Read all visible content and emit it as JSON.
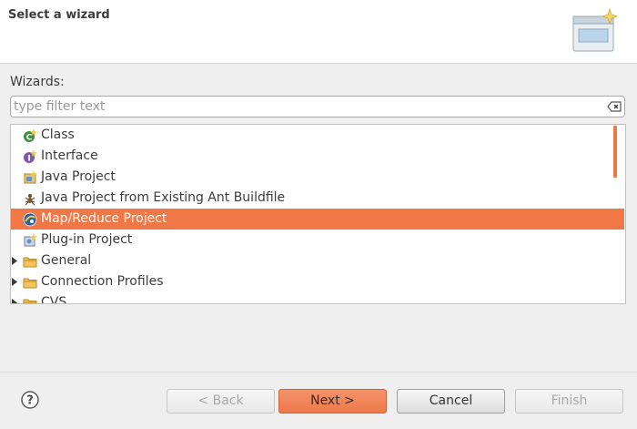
{
  "header": {
    "title": "Select a wizard"
  },
  "wizards": {
    "label": "Wizards:",
    "filter_placeholder": "type filter text",
    "filter_value": ""
  },
  "tree": {
    "items": [
      {
        "label": "Class",
        "icon": "class-icon",
        "expandable": false,
        "selected": false
      },
      {
        "label": "Interface",
        "icon": "interface-icon",
        "expandable": false,
        "selected": false
      },
      {
        "label": "Java Project",
        "icon": "java-project-icon",
        "expandable": false,
        "selected": false
      },
      {
        "label": "Java Project from Existing Ant Buildfile",
        "icon": "ant-icon",
        "expandable": false,
        "selected": false
      },
      {
        "label": "Map/Reduce Project",
        "icon": "mapreduce-project-icon",
        "expandable": false,
        "selected": true
      },
      {
        "label": "Plug-in Project",
        "icon": "plugin-project-icon",
        "expandable": false,
        "selected": false
      },
      {
        "label": "General",
        "icon": "folder-icon",
        "expandable": true,
        "selected": false
      },
      {
        "label": "Connection Profiles",
        "icon": "folder-icon",
        "expandable": true,
        "selected": false
      },
      {
        "label": "CVS",
        "icon": "folder-icon",
        "expandable": true,
        "selected": false
      }
    ]
  },
  "buttons": {
    "back": "< Back",
    "next": "Next >",
    "cancel": "Cancel",
    "finish": "Finish"
  },
  "colors": {
    "accent": "#f07746",
    "background": "#efefef",
    "header": "#ffffff"
  }
}
